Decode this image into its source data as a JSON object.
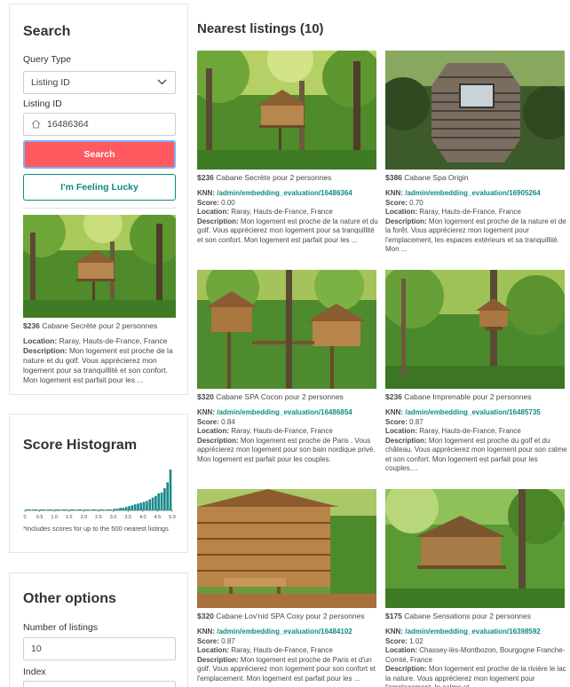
{
  "search": {
    "title": "Search",
    "query_type_label": "Query Type",
    "query_type_value": "Listing ID",
    "listing_id_label": "Listing ID",
    "listing_id_value": "16486364",
    "search_button": "Search",
    "lucky_button": "I'm Feeling Lucky",
    "preview": {
      "price": "$236",
      "title": "Cabane Secrète pour 2 personnes",
      "location_label": "Location:",
      "location": "Raray, Hauts-de-France, France",
      "description_label": "Description:",
      "description": "Mon logement est proche de la nature et du golf. Vous apprécierez mon logement pour sa tranquillité et son confort. Mon logement est parfait pour les ..."
    }
  },
  "histogram": {
    "title": "Score Histogram",
    "footnote": "*Includes scores for up to the 500 nearest listings",
    "bar_color": "#1a8a8a"
  },
  "chart_data": {
    "type": "bar",
    "ticks": [
      "0",
      "0.5",
      "1.0",
      "1.5",
      "2.0",
      "2.5",
      "3.0",
      "3.5",
      "4.0",
      "4.5",
      "5.0"
    ],
    "xlim": [
      0,
      5.0
    ],
    "bins": [
      0.0,
      0.25,
      0.5,
      0.75,
      1.0,
      1.25,
      1.5,
      1.75,
      2.0,
      2.25,
      2.5,
      2.75,
      3.0,
      3.1,
      3.2,
      3.3,
      3.4,
      3.5,
      3.6,
      3.7,
      3.8,
      3.9,
      4.0,
      4.1,
      4.2,
      4.3,
      4.4,
      4.5,
      4.6,
      4.7,
      4.8,
      4.9
    ],
    "values": [
      1,
      1,
      1,
      1,
      1,
      1,
      1,
      1,
      1,
      1,
      1,
      1,
      2,
      2,
      3,
      3,
      4,
      5,
      6,
      7,
      8,
      9,
      10,
      11,
      13,
      15,
      17,
      20,
      21,
      26,
      33,
      48
    ]
  },
  "options": {
    "title": "Other options",
    "num_listings_label": "Number of listings",
    "num_listings_value": "10",
    "index_label": "Index"
  },
  "results": {
    "title": "Nearest listings (10)",
    "knn_label": "KNN:",
    "score_label": "Score:",
    "location_label": "Location:",
    "description_label": "Description:",
    "cards": [
      {
        "price": "$236",
        "title": "Cabane Secrète pour 2 personnes",
        "link": "/admin/embedding_evaluation/16486364",
        "score": "0.00",
        "location": "Raray, Hauts-de-France, France",
        "description": "Mon logement est proche de la nature et du golf. Vous apprécierez mon logement pour sa tranquillité et son confort. Mon logement est parfait pour les ..."
      },
      {
        "price": "$386",
        "title": "Cabane Spa Origin",
        "link": "/admin/embedding_evaluation/16905264",
        "score": "0.70",
        "location": "Raray, Hauts-de-France, France",
        "description": "Mon logement est proche de la nature et de la forêt. Vous apprécierez mon logement pour l'emplacement, les espaces extérieurs et sa tranquillité. Mon ..."
      },
      {
        "price": "$320",
        "title": "Cabane SPA Cocon pour 2 personnes",
        "link": "/admin/embedding_evaluation/16486854",
        "score": "0.84",
        "location": "Raray, Hauts-de-France, France",
        "description": "Mon logement est proche de Paris . Vous apprécierez mon logement pour son bain nordique privé. Mon logement est parfait pour les couples."
      },
      {
        "price": "$236",
        "title": "Cabane Imprenable pour 2 personnes",
        "link": "/admin/embedding_evaluation/16485735",
        "score": "0.87",
        "location": "Raray, Hauts-de-France, France",
        "description": "Mon logement est proche du golf et du château. Vous apprécierez mon logement pour son calme et son confort. Mon logement est parfait pour les couples...."
      },
      {
        "price": "$320",
        "title": "Cabane Lov'nid SPA Cosy pour 2 personnes",
        "link": "/admin/embedding_evaluation/16484102",
        "score": "0.87",
        "location": "Raray, Hauts-de-France, France",
        "description": "Mon logement est proche de Paris et d'un golf. Vous apprécierez mon logement pour son confort et l'emplacement. Mon logement est parfait pour les ..."
      },
      {
        "price": "$175",
        "title": "Cabane Sensations pour 2 personnes",
        "link": "/admin/embedding_evaluation/16398592",
        "score": "1.02",
        "location": "Chassey-lès-Montbozon, Bourgogne Franche-Comté, France",
        "description": "Mon logement est proche de la rivière le lac la nature. Vous apprécierez mon logement pour l'emplacement, le calme et ..."
      }
    ]
  }
}
